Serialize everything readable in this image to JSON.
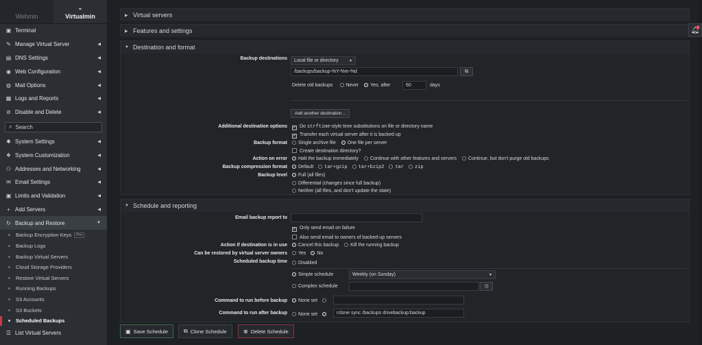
{
  "switcher": {
    "webmin": "Webmin",
    "virtualmin": "Virtualmin"
  },
  "nav": [
    {
      "label": "Terminal",
      "icon": "terminal-icon",
      "glyph": "▣",
      "caret": false
    },
    {
      "label": "Manage Virtual Server",
      "icon": "server-icon",
      "glyph": "✎",
      "caret": true
    },
    {
      "label": "DNS Settings",
      "icon": "dns-icon",
      "glyph": "▤",
      "caret": true
    },
    {
      "label": "Web Configuration",
      "icon": "globe-icon",
      "glyph": "◉",
      "caret": true
    },
    {
      "label": "Mail Options",
      "icon": "mail-icon",
      "glyph": "◍",
      "caret": true
    },
    {
      "label": "Logs and Reports",
      "icon": "logs-icon",
      "glyph": "▦",
      "caret": true
    },
    {
      "label": "Disable and Delete",
      "icon": "disable-icon",
      "glyph": "⊘",
      "caret": true
    }
  ],
  "search_label": "Search",
  "nav2": [
    {
      "label": "System Settings",
      "icon": "gear-icon",
      "glyph": "✱",
      "caret": true
    },
    {
      "label": "System Customization",
      "icon": "customization-icon",
      "glyph": "❖",
      "caret": true
    },
    {
      "label": "Addresses and Networking",
      "icon": "network-icon",
      "glyph": "⚇",
      "caret": true
    },
    {
      "label": "Email Settings",
      "icon": "email-settings-icon",
      "glyph": "✉",
      "caret": true
    },
    {
      "label": "Limits and Validation",
      "icon": "limits-icon",
      "glyph": "▣",
      "caret": true
    },
    {
      "label": "Add Servers",
      "icon": "add-icon",
      "glyph": "+",
      "caret": true
    },
    {
      "label": "Backup and Restore",
      "icon": "backup-icon",
      "glyph": "↻",
      "caret": true
    }
  ],
  "sub_items": [
    {
      "label": "Backup Encryption Keys",
      "pro": "Pro"
    },
    {
      "label": "Backup Logs"
    },
    {
      "label": "Backup Virtual Servers"
    },
    {
      "label": "Cloud Storage Providers"
    },
    {
      "label": "Restore Virtual Servers"
    },
    {
      "label": "Running Backups"
    },
    {
      "label": "S3 Accounts"
    },
    {
      "label": "S3 Buckets"
    },
    {
      "label": "Scheduled Backups",
      "active": true
    }
  ],
  "nav_last": {
    "label": "List Virtual Servers",
    "icon": "list-icon",
    "glyph": "☰"
  },
  "sections": {
    "virtual_servers": "Virtual servers",
    "features": "Features and settings",
    "destination": "Destination and format",
    "schedule": "Schedule and reporting"
  },
  "dest": {
    "backup_destinations": "Backup destinations",
    "dest_type": "Local file or directory",
    "path": "/backups/backup-%Y-%m-%d",
    "delete_old": "Delete old backups",
    "never": "Never",
    "yes_after": "Yes, after",
    "days_value": "60",
    "days": "days",
    "add_another": "Add another destination ..",
    "additional_options": "Additional destination options",
    "do_prefix": "Do",
    "strftime": "strftime",
    "strftime_rest": "-style time substitutions on file or directory name",
    "transfer_each": "Transfer each virtual server after it is backed up",
    "backup_format": "Backup format",
    "single_archive": "Single archive file",
    "one_file_per_server": "One file per server",
    "create_dest_dir": "Create destination directory?",
    "action_on_error": "Action on error",
    "halt": "Halt the backup immediately",
    "continue_other": "Continue with other features and servers",
    "continue_no_purge": "Continue, but don't purge old backups",
    "compression": "Backup compression format",
    "default": "Default",
    "tar_gzip": "tar+gzip",
    "tar_bzip2": "tar+bzip2",
    "tar": "tar",
    "zip": "zip",
    "backup_level": "Backup level",
    "full": "Full (all files)",
    "differential": "Differential (changes since full backup)",
    "neither": "Neither (all files, and don't update the state)"
  },
  "sched": {
    "email_report": "Email backup report to",
    "only_failure": "Only send email on failure",
    "also_owners": "Also send email to owners of backed-up servers",
    "action_in_use": "Action if destination is in use",
    "cancel_backup": "Cancel this backup",
    "kill_running": "Kill the running backup",
    "restored_by_owners": "Can be restored by virtual server owners",
    "yes": "Yes",
    "no": "No",
    "scheduled_time": "Scheduled backup time",
    "disabled": "Disabled",
    "simple": "Simple schedule",
    "simple_value": "Weekly (on Sunday)",
    "complex": "Complex schedule",
    "cmd_before": "Command to run before backup",
    "none_set": "None set",
    "cmd_after": "Command to run after backup",
    "cmd_after_value": "rclone sync /backups drivebackup:backup"
  },
  "buttons": {
    "save": "Save Schedule",
    "clone": "Clone Schedule",
    "delete": "Delete Schedule"
  },
  "notifications_badge": "1"
}
